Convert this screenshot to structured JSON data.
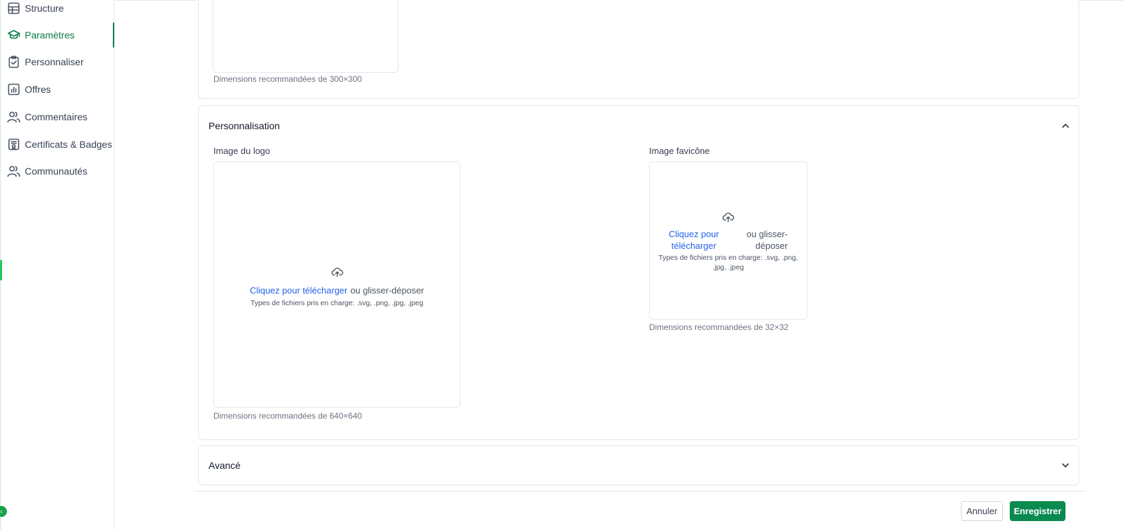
{
  "sidebar": {
    "items": [
      {
        "label": "Structure",
        "icon": "table-icon",
        "active": false
      },
      {
        "label": "Paramètres",
        "icon": "graduation-cap-icon",
        "active": true
      },
      {
        "label": "Personnaliser",
        "icon": "clipboard-check-icon",
        "active": false
      },
      {
        "label": "Offres",
        "icon": "chart-bar-icon",
        "active": false
      },
      {
        "label": "Commentaires",
        "icon": "users-icon",
        "active": false
      },
      {
        "label": "Certificats & Badges",
        "icon": "certificate-icon",
        "active": false
      },
      {
        "label": "Communautés",
        "icon": "users-icon",
        "active": false
      }
    ]
  },
  "top_section": {
    "hint": "Dimensions recommandées de 300×300"
  },
  "personnalisation": {
    "title": "Personnalisation",
    "logo": {
      "label": "Image du logo",
      "click_text": "Cliquez pour télécharger",
      "drag_text": "ou glisser-déposer",
      "types": "Types de fichiers pris en charge: .svg, .png, .jpg, .jpeg",
      "hint": "Dimensions recommandées de 640×640"
    },
    "favicon": {
      "label": "Image favicône",
      "click_text_1": "Cliquez pour",
      "click_text_2": "télécharger",
      "drag_text_1": "ou glisser-",
      "drag_text_2": "déposer",
      "types_1": "Types de fichiers pris en charge: .svg, .png,",
      "types_2": ".jpg, .jpeg",
      "hint": "Dimensions recommandées de 32×32"
    }
  },
  "avance": {
    "title": "Avancé"
  },
  "footer": {
    "cancel_label": "Annuler",
    "save_label": "Enregistrer"
  },
  "colors": {
    "accent": "#087a47",
    "primary_button": "#0b8a4f",
    "link": "#2563eb"
  }
}
